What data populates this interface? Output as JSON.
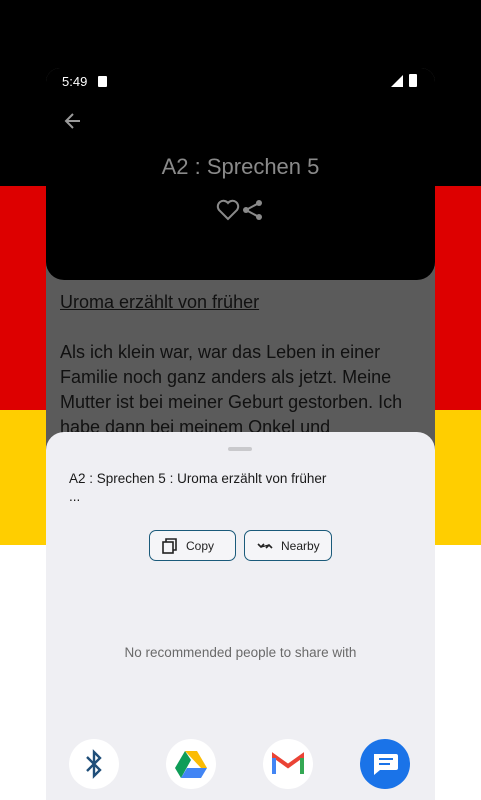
{
  "status_bar": {
    "time": "5:49"
  },
  "header": {
    "title": "A2 : Sprechen 5"
  },
  "content": {
    "lesson_title": "Uroma erzählt von früher",
    "paragraph": "Als ich klein war, war das Leben in einer Familie noch ganz anders als jetzt. Meine Mutter ist bei meiner Geburt gestorben. Ich habe dann bei meinem Onkel und"
  },
  "share_sheet": {
    "share_text_line1": "A2 : Sprechen 5 : Uroma erzählt von früher",
    "share_text_line2": "...",
    "copy_label": "Copy",
    "nearby_label": "Nearby",
    "empty_message": "No recommended people to share with",
    "apps": [
      "bluetooth-icon",
      "google-drive-icon",
      "gmail-icon",
      "messages-icon"
    ]
  },
  "colors": {
    "flag_black": "#000000",
    "flag_red": "#dd0000",
    "flag_gold": "#ffce00",
    "sheet_bg": "#efeff3",
    "chip_border": "#1a5a7a",
    "messages_blue": "#1a73e8"
  }
}
